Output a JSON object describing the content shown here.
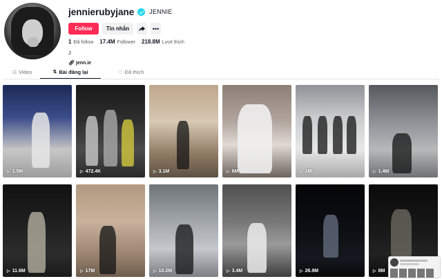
{
  "profile": {
    "username": "jennierubyjane",
    "nickname": "JENNIE",
    "follow_label": "Follow",
    "message_label": "Tin nhắn",
    "share_icon": "share-icon",
    "more_icon": "more-icon",
    "following_count": "1",
    "following_label": "Đã follow",
    "followers_count": "17.4M",
    "followers_label": "Follower",
    "likes_count": "218.8M",
    "likes_label": "Lượt thích",
    "bio": "J",
    "link": "jenn.ie"
  },
  "tabs": [
    {
      "label": "Video",
      "icon": "grid-icon",
      "active": false
    },
    {
      "label": "Bài đăng lại",
      "icon": "repost-icon",
      "active": true
    },
    {
      "label": "Đã thích",
      "icon": "heart-icon",
      "active": false
    }
  ],
  "videos": [
    {
      "views": "1.5M"
    },
    {
      "views": "472.4K"
    },
    {
      "views": "3.1M"
    },
    {
      "views": "6M"
    },
    {
      "views": "1M"
    },
    {
      "views": "1.4M"
    },
    {
      "views": "11.6M"
    },
    {
      "views": "17M"
    },
    {
      "views": "10.2M"
    },
    {
      "views": "3.4M"
    },
    {
      "views": "26.9M"
    },
    {
      "views": "8M"
    }
  ],
  "colors": {
    "accent": "#fe2c55",
    "verified": "#20d5ec",
    "text": "#161823"
  }
}
